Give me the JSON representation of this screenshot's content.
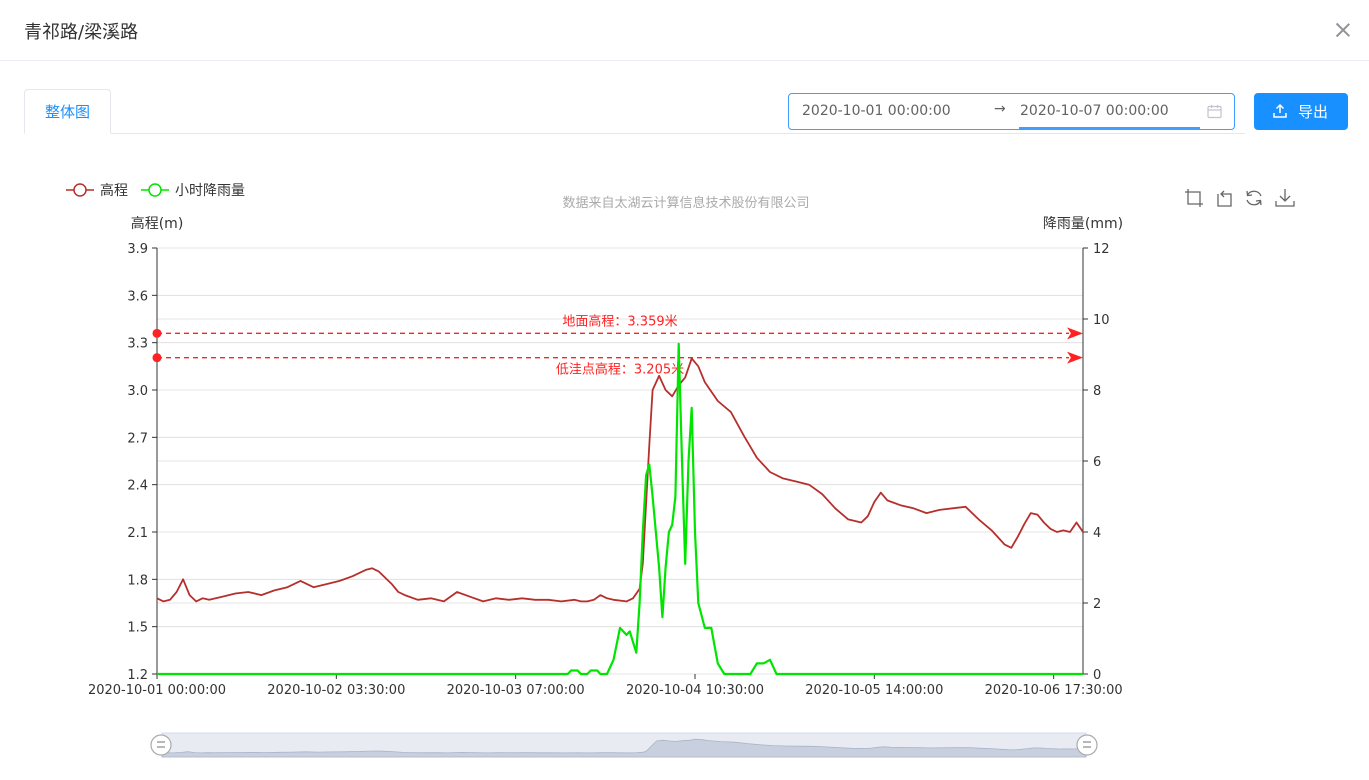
{
  "dialog": {
    "title": "青祁路/梁溪路"
  },
  "tabs": [
    {
      "label": "整体图"
    }
  ],
  "date_range": {
    "start": "2020-10-01 00:00:00",
    "separator": "→",
    "end": "2020-10-07 00:00:00"
  },
  "export_button": {
    "label": "导出"
  },
  "colors": {
    "elevation": "#b5302c",
    "rain": "#00e500",
    "markline": "#ff2222",
    "primary": "#1890ff"
  },
  "chart_data": {
    "type": "line",
    "subtitle": "数据来自太湖云计算信息技术股份有限公司",
    "legend": {
      "position": "top-left",
      "items": [
        "高程",
        "小时降雨量"
      ]
    },
    "y_left": {
      "label": "高程(m)",
      "min": 1.2,
      "max": 3.9,
      "ticks": [
        "1.2",
        "1.5",
        "1.8",
        "2.1",
        "2.4",
        "2.7",
        "3.0",
        "3.3",
        "3.6",
        "3.9"
      ]
    },
    "y_right": {
      "label": "降雨量(mm)",
      "min": 0,
      "max": 12,
      "ticks": [
        "0",
        "2",
        "4",
        "6",
        "8",
        "10",
        "12"
      ]
    },
    "x_axis": {
      "type": "time",
      "start": "2020-10-01 00:00:00",
      "end": "2020-10-06 22:00:00",
      "tick_labels": [
        "2020-10-01 00:00:00",
        "2020-10-02 03:30:00",
        "2020-10-03 07:00:00",
        "2020-10-04 10:30:00",
        "2020-10-05 14:00:00",
        "2020-10-06 17:30:00"
      ]
    },
    "grid": true,
    "mark_lines": [
      {
        "label": "地面高程：3.359米",
        "value": 3.359
      },
      {
        "label": "低洼点高程：3.205米",
        "value": 3.205
      }
    ],
    "series": [
      {
        "name": "高程",
        "axis": "left",
        "points": [
          [
            "2020-10-01 00:00:00",
            1.68
          ],
          [
            "2020-10-01 01:00:00",
            1.66
          ],
          [
            "2020-10-01 02:00:00",
            1.67
          ],
          [
            "2020-10-01 03:00:00",
            1.72
          ],
          [
            "2020-10-01 04:00:00",
            1.8
          ],
          [
            "2020-10-01 05:00:00",
            1.7
          ],
          [
            "2020-10-01 06:00:00",
            1.66
          ],
          [
            "2020-10-01 07:00:00",
            1.68
          ],
          [
            "2020-10-01 08:00:00",
            1.67
          ],
          [
            "2020-10-01 09:00:00",
            1.68
          ],
          [
            "2020-10-01 10:00:00",
            1.69
          ],
          [
            "2020-10-01 12:00:00",
            1.71
          ],
          [
            "2020-10-01 14:00:00",
            1.72
          ],
          [
            "2020-10-01 16:00:00",
            1.7
          ],
          [
            "2020-10-01 18:00:00",
            1.73
          ],
          [
            "2020-10-01 20:00:00",
            1.75
          ],
          [
            "2020-10-01 22:00:00",
            1.79
          ],
          [
            "2020-10-02 00:00:00",
            1.75
          ],
          [
            "2020-10-02 02:00:00",
            1.77
          ],
          [
            "2020-10-02 04:00:00",
            1.79
          ],
          [
            "2020-10-02 06:00:00",
            1.82
          ],
          [
            "2020-10-02 08:00:00",
            1.86
          ],
          [
            "2020-10-02 09:00:00",
            1.87
          ],
          [
            "2020-10-02 10:00:00",
            1.85
          ],
          [
            "2020-10-02 12:00:00",
            1.77
          ],
          [
            "2020-10-02 13:00:00",
            1.72
          ],
          [
            "2020-10-02 14:00:00",
            1.7
          ],
          [
            "2020-10-02 16:00:00",
            1.67
          ],
          [
            "2020-10-02 18:00:00",
            1.68
          ],
          [
            "2020-10-02 20:00:00",
            1.66
          ],
          [
            "2020-10-02 22:00:00",
            1.72
          ],
          [
            "2020-10-03 00:00:00",
            1.69
          ],
          [
            "2020-10-03 02:00:00",
            1.66
          ],
          [
            "2020-10-03 04:00:00",
            1.68
          ],
          [
            "2020-10-03 06:00:00",
            1.67
          ],
          [
            "2020-10-03 08:00:00",
            1.68
          ],
          [
            "2020-10-03 10:00:00",
            1.67
          ],
          [
            "2020-10-03 12:00:00",
            1.67
          ],
          [
            "2020-10-03 14:00:00",
            1.66
          ],
          [
            "2020-10-03 16:00:00",
            1.67
          ],
          [
            "2020-10-03 17:00:00",
            1.66
          ],
          [
            "2020-10-03 18:00:00",
            1.66
          ],
          [
            "2020-10-03 19:00:00",
            1.67
          ],
          [
            "2020-10-03 20:00:00",
            1.7
          ],
          [
            "2020-10-03 21:00:00",
            1.68
          ],
          [
            "2020-10-03 22:00:00",
            1.67
          ],
          [
            "2020-10-04 00:00:00",
            1.66
          ],
          [
            "2020-10-04 01:00:00",
            1.68
          ],
          [
            "2020-10-04 02:00:00",
            1.74
          ],
          [
            "2020-10-04 02:30:00",
            1.9
          ],
          [
            "2020-10-04 03:00:00",
            2.28
          ],
          [
            "2020-10-04 03:30:00",
            2.65
          ],
          [
            "2020-10-04 04:00:00",
            3.0
          ],
          [
            "2020-10-04 05:00:00",
            3.09
          ],
          [
            "2020-10-04 06:00:00",
            3.0
          ],
          [
            "2020-10-04 07:00:00",
            2.96
          ],
          [
            "2020-10-04 08:00:00",
            3.03
          ],
          [
            "2020-10-04 09:00:00",
            3.08
          ],
          [
            "2020-10-04 10:00:00",
            3.2
          ],
          [
            "2020-10-04 11:00:00",
            3.15
          ],
          [
            "2020-10-04 12:00:00",
            3.05
          ],
          [
            "2020-10-04 14:00:00",
            2.93
          ],
          [
            "2020-10-04 16:00:00",
            2.86
          ],
          [
            "2020-10-04 18:00:00",
            2.71
          ],
          [
            "2020-10-04 20:00:00",
            2.57
          ],
          [
            "2020-10-04 22:00:00",
            2.48
          ],
          [
            "2020-10-05 00:00:00",
            2.44
          ],
          [
            "2020-10-05 02:00:00",
            2.42
          ],
          [
            "2020-10-05 04:00:00",
            2.4
          ],
          [
            "2020-10-05 06:00:00",
            2.34
          ],
          [
            "2020-10-05 08:00:00",
            2.25
          ],
          [
            "2020-10-05 10:00:00",
            2.18
          ],
          [
            "2020-10-05 12:00:00",
            2.16
          ],
          [
            "2020-10-05 13:00:00",
            2.2
          ],
          [
            "2020-10-05 14:00:00",
            2.29
          ],
          [
            "2020-10-05 15:00:00",
            2.35
          ],
          [
            "2020-10-05 16:00:00",
            2.3
          ],
          [
            "2020-10-05 18:00:00",
            2.27
          ],
          [
            "2020-10-05 20:00:00",
            2.25
          ],
          [
            "2020-10-05 22:00:00",
            2.22
          ],
          [
            "2020-10-06 00:00:00",
            2.24
          ],
          [
            "2020-10-06 02:00:00",
            2.25
          ],
          [
            "2020-10-06 04:00:00",
            2.26
          ],
          [
            "2020-10-06 06:00:00",
            2.18
          ],
          [
            "2020-10-06 08:00:00",
            2.11
          ],
          [
            "2020-10-06 10:00:00",
            2.02
          ],
          [
            "2020-10-06 11:00:00",
            2.0
          ],
          [
            "2020-10-06 12:00:00",
            2.07
          ],
          [
            "2020-10-06 13:00:00",
            2.15
          ],
          [
            "2020-10-06 14:00:00",
            2.22
          ],
          [
            "2020-10-06 15:00:00",
            2.21
          ],
          [
            "2020-10-06 16:00:00",
            2.16
          ],
          [
            "2020-10-06 17:00:00",
            2.12
          ],
          [
            "2020-10-06 18:00:00",
            2.1
          ],
          [
            "2020-10-06 19:00:00",
            2.11
          ],
          [
            "2020-10-06 20:00:00",
            2.1
          ],
          [
            "2020-10-06 21:00:00",
            2.16
          ],
          [
            "2020-10-06 22:00:00",
            2.1
          ]
        ]
      },
      {
        "name": "小时降雨量",
        "axis": "right",
        "points": [
          [
            "2020-10-01 00:00:00",
            0
          ],
          [
            "2020-10-03 15:00:00",
            0
          ],
          [
            "2020-10-03 15:30:00",
            0.1
          ],
          [
            "2020-10-03 16:30:00",
            0.1
          ],
          [
            "2020-10-03 17:00:00",
            0
          ],
          [
            "2020-10-03 18:00:00",
            0
          ],
          [
            "2020-10-03 18:30:00",
            0.1
          ],
          [
            "2020-10-03 19:30:00",
            0.1
          ],
          [
            "2020-10-03 20:00:00",
            0
          ],
          [
            "2020-10-03 21:00:00",
            0
          ],
          [
            "2020-10-03 22:00:00",
            0.4
          ],
          [
            "2020-10-03 23:00:00",
            1.3
          ],
          [
            "2020-10-04 00:00:00",
            1.1
          ],
          [
            "2020-10-04 00:30:00",
            1.2
          ],
          [
            "2020-10-04 01:00:00",
            0.9
          ],
          [
            "2020-10-04 01:30:00",
            0.6
          ],
          [
            "2020-10-04 02:00:00",
            2.0
          ],
          [
            "2020-10-04 02:30:00",
            4.0
          ],
          [
            "2020-10-04 03:00:00",
            5.6
          ],
          [
            "2020-10-04 03:30:00",
            5.9
          ],
          [
            "2020-10-04 04:00:00",
            5.0
          ],
          [
            "2020-10-04 05:00:00",
            3.0
          ],
          [
            "2020-10-04 05:30:00",
            1.6
          ],
          [
            "2020-10-04 06:00:00",
            3.0
          ],
          [
            "2020-10-04 06:30:00",
            4.0
          ],
          [
            "2020-10-04 07:00:00",
            4.2
          ],
          [
            "2020-10-04 07:30:00",
            5.0
          ],
          [
            "2020-10-04 08:00:00",
            9.3
          ],
          [
            "2020-10-04 08:30:00",
            6.0
          ],
          [
            "2020-10-04 09:00:00",
            3.1
          ],
          [
            "2020-10-04 09:30:00",
            6.0
          ],
          [
            "2020-10-04 10:00:00",
            7.5
          ],
          [
            "2020-10-04 10:30:00",
            4.0
          ],
          [
            "2020-10-04 11:00:00",
            2.0
          ],
          [
            "2020-10-04 12:00:00",
            1.3
          ],
          [
            "2020-10-04 13:00:00",
            1.3
          ],
          [
            "2020-10-04 14:00:00",
            0.3
          ],
          [
            "2020-10-04 15:00:00",
            0
          ],
          [
            "2020-10-04 19:00:00",
            0
          ],
          [
            "2020-10-04 20:00:00",
            0.3
          ],
          [
            "2020-10-04 21:00:00",
            0.3
          ],
          [
            "2020-10-04 22:00:00",
            0.4
          ],
          [
            "2020-10-04 23:00:00",
            0
          ],
          [
            "2020-10-06 22:00:00",
            0
          ]
        ]
      }
    ]
  }
}
